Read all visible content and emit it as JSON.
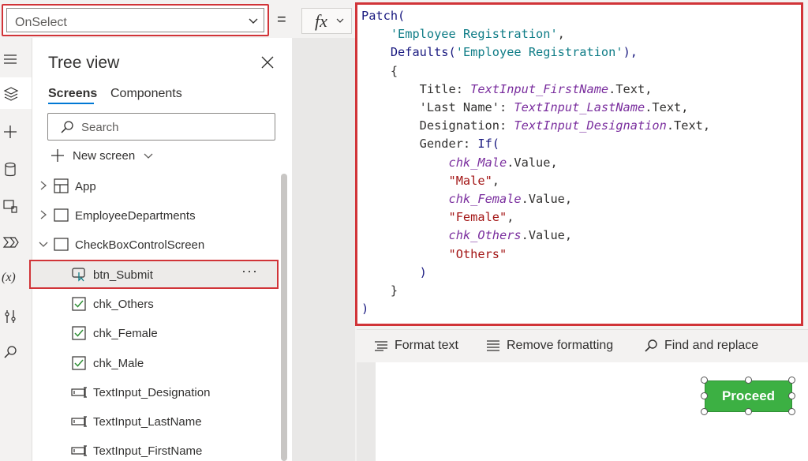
{
  "property_selector": {
    "value": "OnSelect"
  },
  "formula_bar": {
    "equals": "=",
    "fx_label": "fx",
    "lines": [
      [
        {
          "t": "Patch(",
          "c": "c-fn"
        }
      ],
      [
        {
          "t": "    ",
          "c": "c-plain"
        },
        {
          "t": "'Employee Registration'",
          "c": "c-tbl"
        },
        {
          "t": ",",
          "c": "c-plain"
        }
      ],
      [
        {
          "t": "    ",
          "c": "c-plain"
        },
        {
          "t": "Defaults(",
          "c": "c-fn"
        },
        {
          "t": "'Employee Registration'",
          "c": "c-tbl"
        },
        {
          "t": "),",
          "c": "c-fn"
        }
      ],
      [
        {
          "t": "    {",
          "c": "c-plain"
        }
      ],
      [
        {
          "t": "        Title: ",
          "c": "c-plain"
        },
        {
          "t": "TextInput_FirstName",
          "c": "c-var"
        },
        {
          "t": ".Text,",
          "c": "c-plain"
        }
      ],
      [
        {
          "t": "        'Last Name': ",
          "c": "c-plain"
        },
        {
          "t": "TextInput_LastName",
          "c": "c-var"
        },
        {
          "t": ".Text,",
          "c": "c-plain"
        }
      ],
      [
        {
          "t": "        Designation: ",
          "c": "c-plain"
        },
        {
          "t": "TextInput_Designation",
          "c": "c-var"
        },
        {
          "t": ".Text,",
          "c": "c-plain"
        }
      ],
      [
        {
          "t": "        Gender: ",
          "c": "c-plain"
        },
        {
          "t": "If(",
          "c": "c-fn"
        }
      ],
      [
        {
          "t": "            ",
          "c": "c-plain"
        },
        {
          "t": "chk_Male",
          "c": "c-var"
        },
        {
          "t": ".Value,",
          "c": "c-plain"
        }
      ],
      [
        {
          "t": "            ",
          "c": "c-plain"
        },
        {
          "t": "\"Male\"",
          "c": "c-str"
        },
        {
          "t": ",",
          "c": "c-plain"
        }
      ],
      [
        {
          "t": "            ",
          "c": "c-plain"
        },
        {
          "t": "chk_Female",
          "c": "c-var"
        },
        {
          "t": ".Value,",
          "c": "c-plain"
        }
      ],
      [
        {
          "t": "            ",
          "c": "c-plain"
        },
        {
          "t": "\"Female\"",
          "c": "c-str"
        },
        {
          "t": ",",
          "c": "c-plain"
        }
      ],
      [
        {
          "t": "            ",
          "c": "c-plain"
        },
        {
          "t": "chk_Others",
          "c": "c-var"
        },
        {
          "t": ".Value,",
          "c": "c-plain"
        }
      ],
      [
        {
          "t": "            ",
          "c": "c-plain"
        },
        {
          "t": "\"Others\"",
          "c": "c-str"
        }
      ],
      [
        {
          "t": "        )",
          "c": "c-fn"
        }
      ],
      [
        {
          "t": "    }",
          "c": "c-plain"
        }
      ],
      [
        {
          "t": ")",
          "c": "c-fn"
        }
      ]
    ]
  },
  "formula_toolbar": {
    "format_text": "Format text",
    "remove_formatting": "Remove formatting",
    "find_replace": "Find and replace"
  },
  "tree_view": {
    "title": "Tree view",
    "tabs": {
      "screens": "Screens",
      "components": "Components"
    },
    "search_placeholder": "Search",
    "new_screen": "New screen",
    "nodes": {
      "app": "App",
      "employee_departments": "EmployeeDepartments",
      "checkbox_screen": "CheckBoxControlScreen",
      "btn_submit": "btn_Submit",
      "chk_others": "chk_Others",
      "chk_female": "chk_Female",
      "chk_male": "chk_Male",
      "ti_designation": "TextInput_Designation",
      "ti_lastname": "TextInput_LastName",
      "ti_firstname": "TextInput_FirstName"
    },
    "more": "···"
  },
  "canvas": {
    "proceed_label": "Proceed"
  },
  "colors": {
    "highlight": "#d13438",
    "accent": "#0078d4",
    "button": "#3cb043"
  }
}
